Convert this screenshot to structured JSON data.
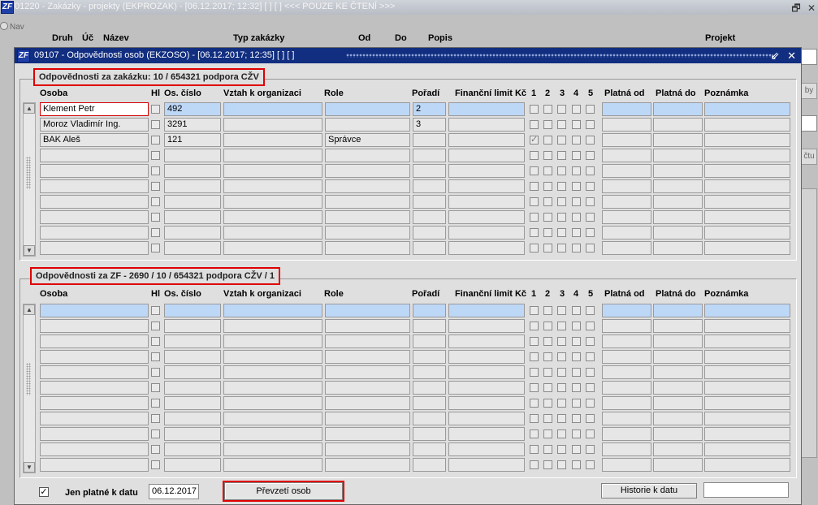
{
  "background_window": {
    "title": "01220 - Zakázky - projekty (EKPROZAK) - [06.12.2017; 12:32]  [ ]  [ ] <<< POUZE KE ČTENÍ >>>",
    "nav_label": "Nav",
    "headers": [
      "Druh",
      "Úč",
      "Název",
      "Typ zakázky",
      "Od",
      "Do",
      "Popis",
      "Projekt"
    ],
    "btn_partial_1": "by",
    "btn_partial_2": "čtu"
  },
  "modal": {
    "title": "09107 - Odpovědnosti osob (EKZOSO) - [06.12.2017; 12:35]  [ ]  [ ]",
    "icon_label": "ZF"
  },
  "columns": {
    "osoba": "Osoba",
    "hl": "Hl",
    "os_cislo": "Os. číslo",
    "vztah": "Vztah k organizaci",
    "role": "Role",
    "poradi": "Pořadí",
    "fin_limit": "Finanční limit Kč",
    "c1": "1",
    "c2": "2",
    "c3": "3",
    "c4": "4",
    "c5": "5",
    "platna_od": "Platná od",
    "platna_do": "Platná do",
    "poznamka": "Poznámka"
  },
  "section1": {
    "title": "Odpovědnosti za zakázku: 10 / 654321 podpora CŽV",
    "rows": [
      {
        "osoba": "Klement Petr",
        "os_cislo": "492",
        "vztah": "",
        "role": "",
        "poradi": "2",
        "fin_limit": "",
        "platna_od": "",
        "platna_do": "",
        "poznamka": "",
        "checks": [
          false,
          false,
          false,
          false,
          false
        ],
        "hl": false
      },
      {
        "osoba": "Moroz Vladimír Ing.",
        "os_cislo": "3291",
        "vztah": "",
        "role": "",
        "poradi": "3",
        "fin_limit": "",
        "platna_od": "",
        "platna_do": "",
        "poznamka": "",
        "checks": [
          false,
          false,
          false,
          false,
          false
        ],
        "hl": false
      },
      {
        "osoba": "BAK Aleš",
        "os_cislo": "121",
        "vztah": "",
        "role": "Správce",
        "poradi": "",
        "fin_limit": "",
        "platna_od": "",
        "platna_do": "",
        "poznamka": "",
        "checks": [
          true,
          false,
          false,
          false,
          false
        ],
        "hl": false
      },
      {
        "osoba": "",
        "os_cislo": "",
        "vztah": "",
        "role": "",
        "poradi": "",
        "fin_limit": "",
        "platna_od": "",
        "platna_do": "",
        "poznamka": "",
        "checks": [
          false,
          false,
          false,
          false,
          false
        ],
        "hl": false
      },
      {
        "osoba": "",
        "os_cislo": "",
        "vztah": "",
        "role": "",
        "poradi": "",
        "fin_limit": "",
        "platna_od": "",
        "platna_do": "",
        "poznamka": "",
        "checks": [
          false,
          false,
          false,
          false,
          false
        ],
        "hl": false
      },
      {
        "osoba": "",
        "os_cislo": "",
        "vztah": "",
        "role": "",
        "poradi": "",
        "fin_limit": "",
        "platna_od": "",
        "platna_do": "",
        "poznamka": "",
        "checks": [
          false,
          false,
          false,
          false,
          false
        ],
        "hl": false
      },
      {
        "osoba": "",
        "os_cislo": "",
        "vztah": "",
        "role": "",
        "poradi": "",
        "fin_limit": "",
        "platna_od": "",
        "platna_do": "",
        "poznamka": "",
        "checks": [
          false,
          false,
          false,
          false,
          false
        ],
        "hl": false
      },
      {
        "osoba": "",
        "os_cislo": "",
        "vztah": "",
        "role": "",
        "poradi": "",
        "fin_limit": "",
        "platna_od": "",
        "platna_do": "",
        "poznamka": "",
        "checks": [
          false,
          false,
          false,
          false,
          false
        ],
        "hl": false
      },
      {
        "osoba": "",
        "os_cislo": "",
        "vztah": "",
        "role": "",
        "poradi": "",
        "fin_limit": "",
        "platna_od": "",
        "platna_do": "",
        "poznamka": "",
        "checks": [
          false,
          false,
          false,
          false,
          false
        ],
        "hl": false
      },
      {
        "osoba": "",
        "os_cislo": "",
        "vztah": "",
        "role": "",
        "poradi": "",
        "fin_limit": "",
        "platna_od": "",
        "platna_do": "",
        "poznamka": "",
        "checks": [
          false,
          false,
          false,
          false,
          false
        ],
        "hl": false
      }
    ]
  },
  "section2": {
    "title": "Odpovědnosti za ZF - 2690 / 10 / 654321 podpora CŽV / 1",
    "row_count": 11
  },
  "footer": {
    "valid_only_label": "Jen platné k datu",
    "valid_only_checked": true,
    "check_mark": "✓",
    "valid_date": "06.12.2017",
    "prevzeti_label": "Převzetí osob",
    "historie_label": "Historie k datu"
  },
  "icons": {
    "minimize": "🗗",
    "close": "✕",
    "modal_restore": "⇙",
    "scroll_up": "▲",
    "scroll_down": "▼"
  }
}
